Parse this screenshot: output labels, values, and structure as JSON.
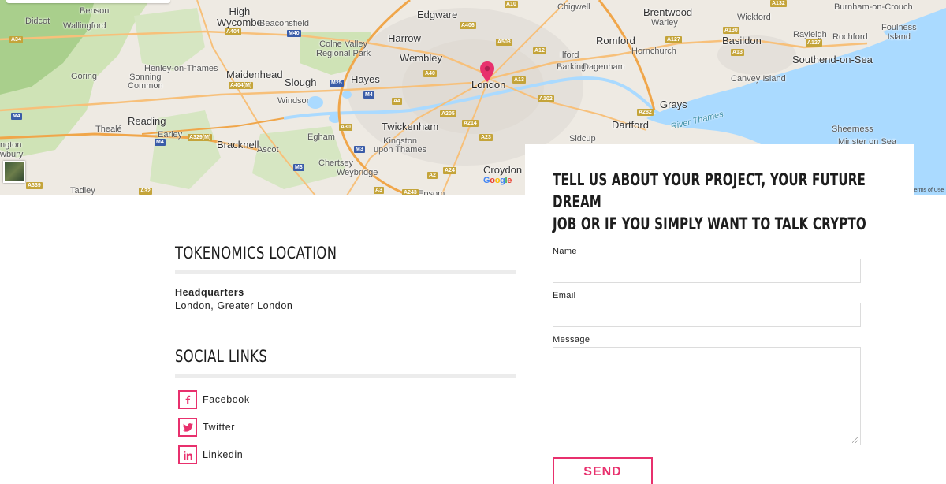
{
  "map": {
    "places": [
      {
        "name": "Benson"
      },
      {
        "name": "High\nWycombe"
      },
      {
        "name": "Beaconsfield"
      },
      {
        "name": "Edgware"
      },
      {
        "name": "Chigwell"
      },
      {
        "name": "Brentwood"
      },
      {
        "name": "Wickford"
      },
      {
        "name": "Burnham-on-Crouch"
      },
      {
        "name": "Didcot"
      },
      {
        "name": "Wallingford"
      },
      {
        "name": "Colne Valley\nRegional Park"
      },
      {
        "name": "Harrow"
      },
      {
        "name": "Romford"
      },
      {
        "name": "Warley"
      },
      {
        "name": "Basildon"
      },
      {
        "name": "Rayleigh"
      },
      {
        "name": "Rochford"
      },
      {
        "name": "Foulness\nIsland"
      },
      {
        "name": "Wembley"
      },
      {
        "name": "Ilford"
      },
      {
        "name": "Hornchurch"
      },
      {
        "name": "Southend-on-Sea"
      },
      {
        "name": "Barking"
      },
      {
        "name": "Dagenham"
      },
      {
        "name": "Henley-on-Thames"
      },
      {
        "name": "Goring"
      },
      {
        "name": "Sonning\nCommon"
      },
      {
        "name": "Maidenhead"
      },
      {
        "name": "Hayes"
      },
      {
        "name": "Slough"
      },
      {
        "name": "Canvey Island"
      },
      {
        "name": "Windsor"
      },
      {
        "name": "Grays"
      },
      {
        "name": "Reading"
      },
      {
        "name": "Twickenham"
      },
      {
        "name": "Dartford"
      },
      {
        "name": "Sheerness"
      },
      {
        "name": "Thealé"
      },
      {
        "name": "Earley"
      },
      {
        "name": "Egham"
      },
      {
        "name": "Kingston\nupon Thames"
      },
      {
        "name": "Sidcup"
      },
      {
        "name": "Minster on Sea"
      },
      {
        "name": "ngton"
      },
      {
        "name": "Bracknell"
      },
      {
        "name": "Ascot"
      },
      {
        "name": "Chertsey"
      },
      {
        "name": "Weybridge"
      },
      {
        "name": "Croydon"
      },
      {
        "name": "Tadley"
      },
      {
        "name": "Epsom"
      },
      {
        "name": "wbury"
      }
    ],
    "city_label": "London",
    "river_label": "River Thames",
    "roads": [
      {
        "ref": "A34"
      },
      {
        "ref": "A404"
      },
      {
        "ref": "M40"
      },
      {
        "ref": "A406"
      },
      {
        "ref": "A10"
      },
      {
        "ref": "A503"
      },
      {
        "ref": "A12"
      },
      {
        "ref": "A127"
      },
      {
        "ref": "A130"
      },
      {
        "ref": "A132"
      },
      {
        "ref": "A13"
      },
      {
        "ref": "A127"
      },
      {
        "ref": "A404(M)"
      },
      {
        "ref": "M25"
      },
      {
        "ref": "A40"
      },
      {
        "ref": "A13"
      },
      {
        "ref": "M4"
      },
      {
        "ref": "A4"
      },
      {
        "ref": "A102"
      },
      {
        "ref": "A282"
      },
      {
        "ref": "A205"
      },
      {
        "ref": "A214"
      },
      {
        "ref": "M4"
      },
      {
        "ref": "A30"
      },
      {
        "ref": "M4"
      },
      {
        "ref": "A329(M)"
      },
      {
        "ref": "M3"
      },
      {
        "ref": "A23"
      },
      {
        "ref": "M3"
      },
      {
        "ref": "A24"
      },
      {
        "ref": "A339"
      },
      {
        "ref": "A32"
      },
      {
        "ref": "A3"
      },
      {
        "ref": "A243"
      },
      {
        "ref": "A2"
      }
    ],
    "google_letters": [
      "G",
      "o",
      "o",
      "g",
      "l",
      "e"
    ],
    "terms": "Terms of Use"
  },
  "form": {
    "heading_line1": "Tell us about your project, your future dream",
    "heading_line2": "job or if you simply want to talk crypto",
    "name_label": "Name",
    "name_value": "",
    "email_label": "Email",
    "email_value": "",
    "message_label": "Message",
    "message_value": "",
    "send_label": "SEND"
  },
  "location": {
    "title": "Tokenomics Location",
    "hq_label": "Headquarters",
    "hq_value": "London, Greater London"
  },
  "social": {
    "title": "Social links",
    "items": [
      {
        "label": "Facebook",
        "icon": "facebook-icon"
      },
      {
        "label": "Twitter",
        "icon": "twitter-icon"
      },
      {
        "label": "Linkedin",
        "icon": "linkedin-icon"
      }
    ]
  },
  "colors": {
    "accent": "#e8306d",
    "divider": "#ececec",
    "map_water": "#aadaff",
    "map_park": "#c8dfb0",
    "map_urban": "#e4e0da"
  }
}
